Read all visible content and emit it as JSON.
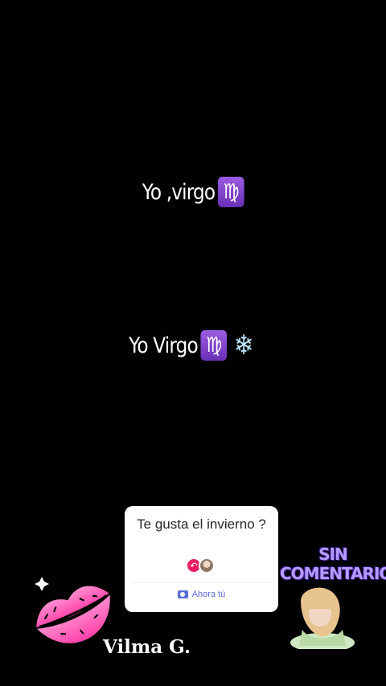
{
  "captions": {
    "line1": {
      "text": "Yo ,virgo",
      "emoji": "♍"
    },
    "line2": {
      "text": "Yo Virgo",
      "emoji": "♍",
      "emoji2": "❄"
    }
  },
  "question_card": {
    "question": "Te gusta el invierno ?",
    "reply_label": "Ahora tú"
  },
  "stickers": {
    "signature": "Vilma G.",
    "sin_comentarios_line1": "SIN",
    "sin_comentarios_line2": "COMENTARIOS"
  },
  "colors": {
    "background": "#000000",
    "card": "#ffffff",
    "accent": "#5b6bd6",
    "lips": "#ff5fb8"
  }
}
